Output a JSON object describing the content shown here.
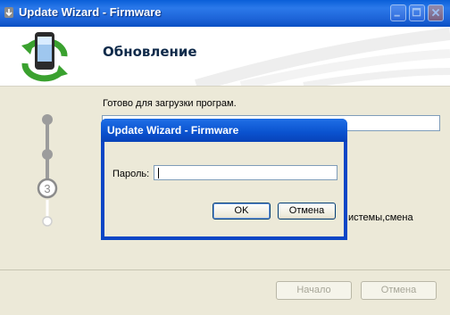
{
  "window": {
    "title": "Update Wizard - Firmware",
    "controls": [
      "minimize",
      "maximize",
      "close"
    ]
  },
  "header": {
    "title": "Обновление",
    "logo_icon": "phone-sync-icon"
  },
  "content": {
    "ready_label": "Готово для загрузки програм.",
    "path_value": "",
    "partial_text": "истемы,смена",
    "steps": [
      {
        "state": "done"
      },
      {
        "state": "done"
      },
      {
        "state": "current",
        "number": "3"
      },
      {
        "state": "pending"
      }
    ]
  },
  "footer": {
    "start_label": "Начало",
    "cancel_label": "Отмена"
  },
  "dialog": {
    "title": "Update Wizard - Firmware",
    "password_label": "Пароль:",
    "password_value": "",
    "ok_label": "OK",
    "cancel_label": "Отмена"
  },
  "colors": {
    "titlebar": "#0a5fd8",
    "dialog_frame": "#0b46c6",
    "window_bg": "#ece9d8",
    "logo_green": "#3aa12f"
  }
}
